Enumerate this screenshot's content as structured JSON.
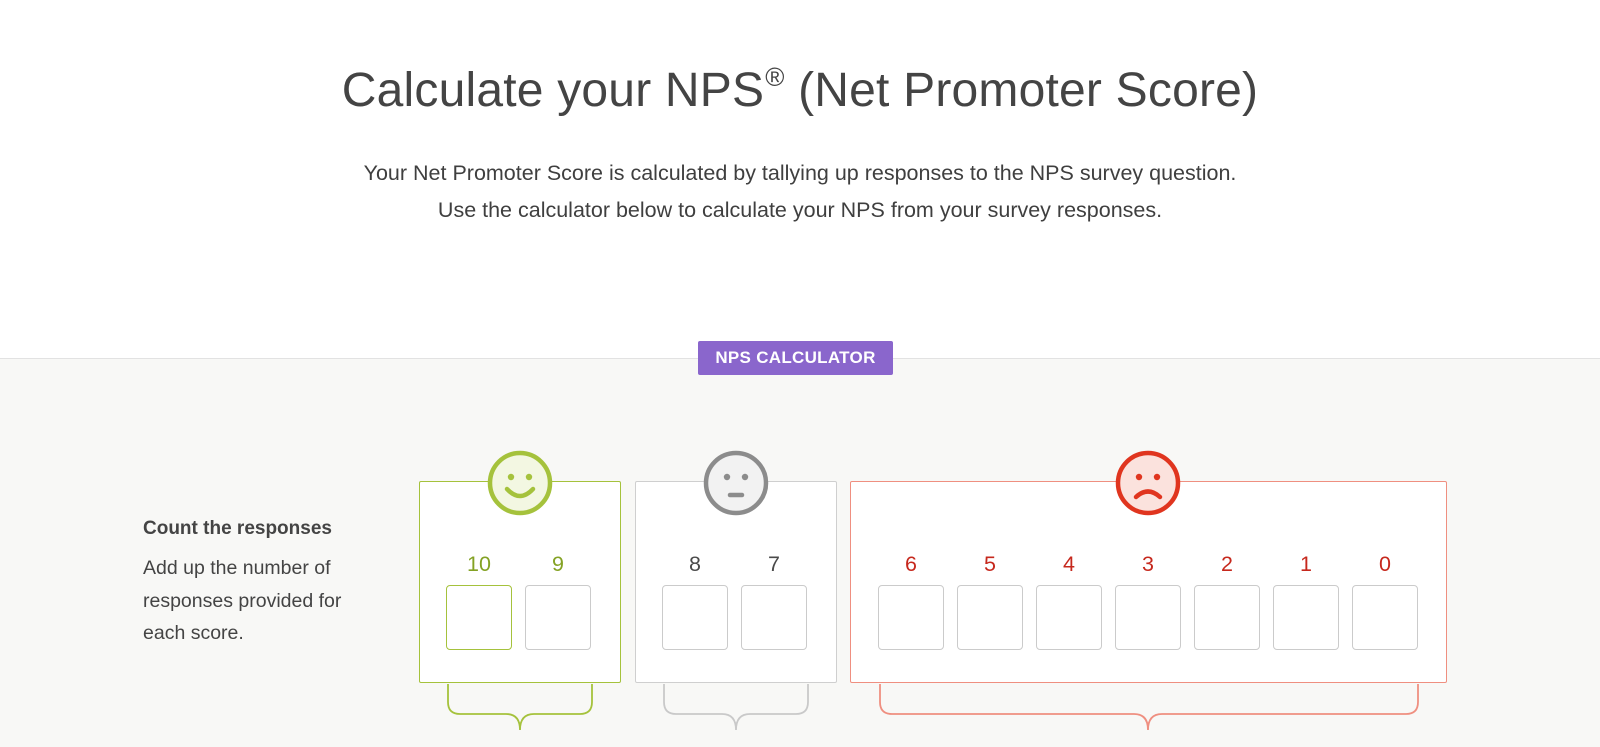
{
  "header": {
    "title": "Calculate your NPS",
    "title_mark": "®",
    "title_suffix": " (Net Promoter Score)",
    "intro_line1": "Your Net Promoter Score is calculated by tallying up responses to the NPS survey question.",
    "intro_line2": "Use the calculator below to calculate your NPS from your survey responses."
  },
  "calculator": {
    "badge": "NPS CALCULATOR",
    "step_title": "Count the responses",
    "step_description": "Add up the number of responses provided for each score.",
    "groups": [
      {
        "kind": "promoters",
        "icon": "happy-face-icon",
        "color": "#a5c23c",
        "scores": [
          "10",
          "9"
        ]
      },
      {
        "kind": "passives",
        "icon": "neutral-face-icon",
        "color": "#8c8c8c",
        "scores": [
          "8",
          "7"
        ]
      },
      {
        "kind": "detractors",
        "icon": "sad-face-icon",
        "color": "#e0351f",
        "scores": [
          "6",
          "5",
          "4",
          "3",
          "2",
          "1",
          "0"
        ]
      }
    ],
    "inputs": {
      "s10": "",
      "s9": "",
      "s8": "",
      "s7": "",
      "s6": "",
      "s5": "",
      "s4": "",
      "s3": "",
      "s2": "",
      "s1": "",
      "s0": ""
    }
  }
}
